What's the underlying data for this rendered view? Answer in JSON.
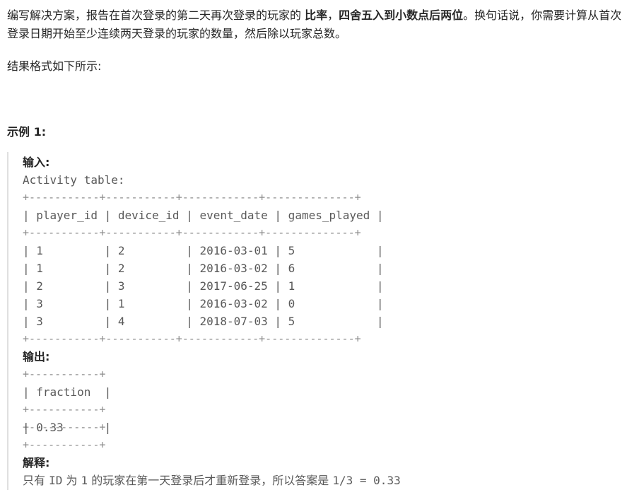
{
  "intro": {
    "t1": "编写解决方案，报告在首次登录的第二天再次登录的玩家的 ",
    "b1": "比率",
    "t2": "，",
    "b2": "四舍五入到小数点后两位",
    "t3": "。换句话说，你需要计算从首次登录日期开始至少连续两天登录的玩家的数量，然后除以玩家总数。"
  },
  "format_text": "结果格式如下所示:",
  "example": {
    "heading": "示例 1:",
    "input_label": "输入:",
    "table_caption": "Activity table:",
    "activity_table": {
      "columns": [
        "player_id",
        "device_id",
        "event_date",
        "games_played"
      ],
      "rows": [
        [
          "1",
          "2",
          "2016-03-01",
          "5"
        ],
        [
          "1",
          "2",
          "2016-03-02",
          "6"
        ],
        [
          "2",
          "3",
          "2017-06-25",
          "1"
        ],
        [
          "3",
          "1",
          "2016-03-02",
          "0"
        ],
        [
          "3",
          "4",
          "2018-07-03",
          "5"
        ]
      ]
    },
    "output_label": "输出:",
    "output_table": {
      "columns": [
        "fraction"
      ],
      "rows": [
        [
          "0.33"
        ]
      ]
    },
    "explain_label": "解释:",
    "explain": {
      "t1": "只有 ",
      "c1": "ID",
      "t2": " 为 ",
      "c2": "1",
      "t3": " 的玩家在第一天登录后才重新登录，所以答案是 ",
      "c3": "1/3 = 0.33"
    }
  }
}
